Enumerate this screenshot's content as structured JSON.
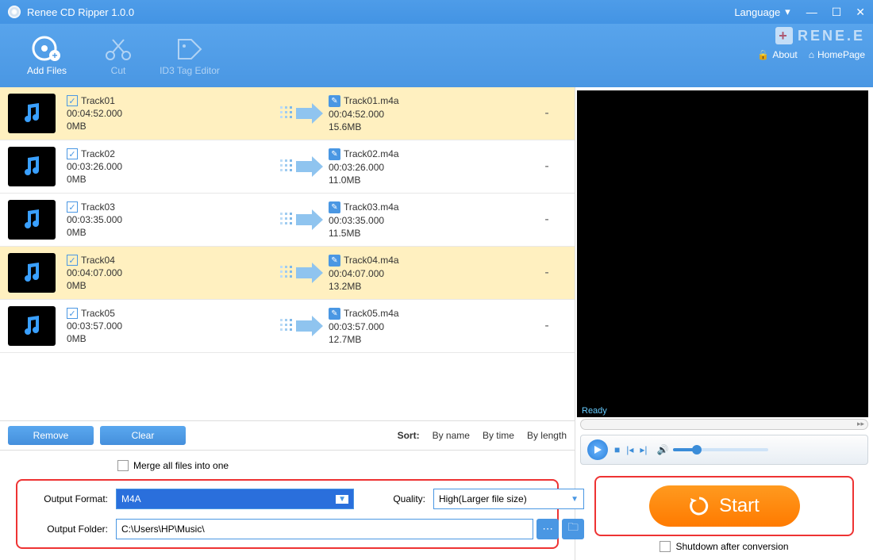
{
  "title": "Renee CD Ripper 1.0.0",
  "lang_label": "Language",
  "brand": "RENE.E",
  "about": "About",
  "homepage": "HomePage",
  "cmd": {
    "add": "Add Files",
    "cut": "Cut",
    "id3": "ID3 Tag Editor"
  },
  "tracks": [
    {
      "name": "Track01",
      "dur": "00:04:52.000",
      "size": "0MB",
      "out": "Track01.m4a",
      "odur": "00:04:52.000",
      "osize": "15.6MB",
      "status": "-",
      "hl": true
    },
    {
      "name": "Track02",
      "dur": "00:03:26.000",
      "size": "0MB",
      "out": "Track02.m4a",
      "odur": "00:03:26.000",
      "osize": "11.0MB",
      "status": "-",
      "hl": false
    },
    {
      "name": "Track03",
      "dur": "00:03:35.000",
      "size": "0MB",
      "out": "Track03.m4a",
      "odur": "00:03:35.000",
      "osize": "11.5MB",
      "status": "-",
      "hl": false
    },
    {
      "name": "Track04",
      "dur": "00:04:07.000",
      "size": "0MB",
      "out": "Track04.m4a",
      "odur": "00:04:07.000",
      "osize": "13.2MB",
      "status": "-",
      "hl": true
    },
    {
      "name": "Track05",
      "dur": "00:03:57.000",
      "size": "0MB",
      "out": "Track05.m4a",
      "odur": "00:03:57.000",
      "osize": "12.7MB",
      "status": "-",
      "hl": false
    }
  ],
  "remove": "Remove",
  "clear": "Clear",
  "sort": {
    "label": "Sort:",
    "name": "By name",
    "time": "By time",
    "length": "By length"
  },
  "merge": "Merge all files into one",
  "ofmt_label": "Output Format:",
  "ofmt_value": "M4A",
  "quality_label": "Quality:",
  "quality_value": "High(Larger file size)",
  "ofold_label": "Output Folder:",
  "ofold_value": "C:\\Users\\HP\\Music\\",
  "ready": "Ready",
  "start": "Start",
  "shutdown": "Shutdown after conversion"
}
